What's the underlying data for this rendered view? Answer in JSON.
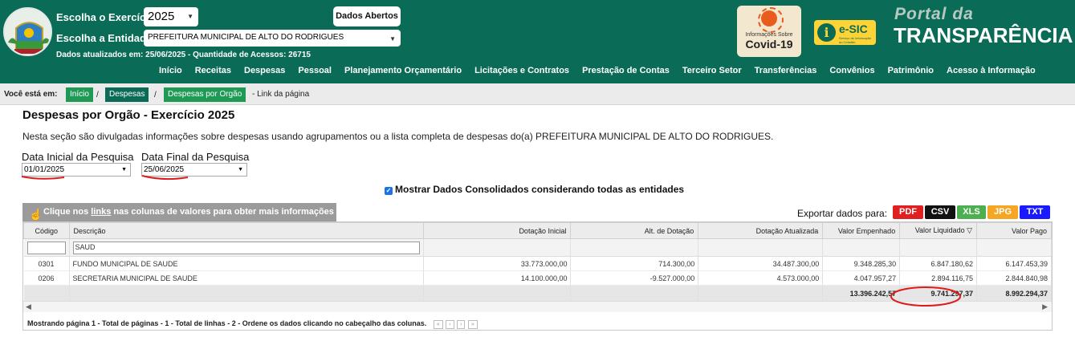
{
  "header": {
    "exercicio_label": "Escolha o Exercício:",
    "exercicio_value": "2025",
    "entidade_label": "Escolha a Entidade:",
    "entidade_value": "PREFEITURA MUNICIPAL DE ALTO DO RODRIGUES",
    "dados_abertos": "Dados Abertos",
    "updated": "Dados atualizados em: 25/06/2025 - Quantidade de Acessos: 26715",
    "covid_small": "Informações Sobre",
    "covid_big": "Covid-19",
    "esic_label": "e-SIC",
    "esic_sub": "Serviço de Informação ao Cidadão",
    "portal_small": "Portal da",
    "portal_big": "TRANSPARÊNCIA"
  },
  "nav": [
    "Início",
    "Receitas",
    "Despesas",
    "Pessoal",
    "Planejamento Orçamentário",
    "Licitações e Contratos",
    "Prestação de Contas",
    "Terceiro Setor",
    "Transferências",
    "Convênios",
    "Patrimônio",
    "Acesso à Informação"
  ],
  "breadcrumb": {
    "label": "Você está em:",
    "items": [
      "Início",
      "Despesas",
      "Despesas por Orgão"
    ],
    "sep": "/",
    "link": "- Link da página"
  },
  "main": {
    "title": "Despesas por Orgão - Exercício 2025",
    "intro": "Nesta seção são divulgadas informações sobre despesas usando agrupamentos ou a lista completa de despesas do(a) PREFEITURA MUNICIPAL DE ALTO DO RODRIGUES.",
    "data_inicial_label": "Data Inicial da Pesquisa",
    "data_inicial_value": "01/01/2025",
    "data_final_label": "Data Final da Pesquisa",
    "data_final_value": "25/06/2025",
    "consolidado": "Mostrar Dados Consolidados considerando todas as entidades"
  },
  "hint": {
    "pre": "Clique nos ",
    "link": "links",
    "post": " nas colunas de valores para obter mais informações"
  },
  "export": {
    "label": "Exportar dados para:",
    "formats": [
      "PDF",
      "CSV",
      "XLS",
      "JPG",
      "TXT"
    ],
    "colors": [
      "#e02020",
      "#111111",
      "#4caf50",
      "#f5a623",
      "#1a1aff"
    ]
  },
  "table": {
    "headers": [
      "Código",
      "Descrição",
      "Dotação Inicial",
      "Alt. de Dotação",
      "Dotação Atualizada",
      "Valor Empenhado",
      "Valor Liquidado ▽",
      "Valor Pago"
    ],
    "filter_descricao": "SAUD",
    "rows": [
      [
        "0301",
        "FUNDO MUNICIPAL DE SAUDE",
        "33.773.000,00",
        "714.300,00",
        "34.487.300,00",
        "9.348.285,30",
        "6.847.180,62",
        "6.147.453,39"
      ],
      [
        "0206",
        "SECRETARIA MUNICIPAL DE SAUDE",
        "14.100.000,00",
        "-9.527.000,00",
        "4.573.000,00",
        "4.047.957,27",
        "2.894.116,75",
        "2.844.840,98"
      ]
    ],
    "totals": [
      "13.396.242,57",
      "9.741.297,37",
      "8.992.294,37"
    ]
  },
  "pager": {
    "text": "Mostrando página 1 - Total de páginas - 1 - Total de linhas - 2 - Ordene os dados clicando no cabeçalho das colunas.",
    "buttons": [
      "«",
      "‹",
      "›",
      "»"
    ]
  }
}
